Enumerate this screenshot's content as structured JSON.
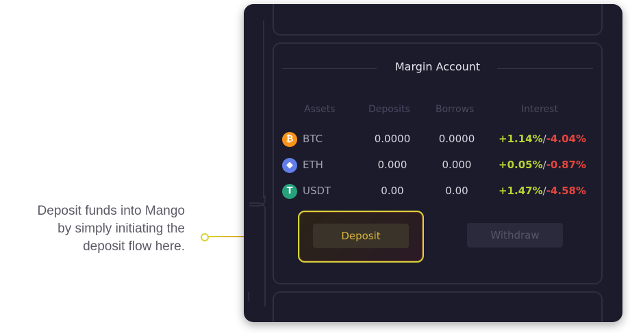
{
  "callout": {
    "lines": [
      "Deposit funds into Mango",
      "by simply initiating the",
      "deposit flow here."
    ]
  },
  "margin_account": {
    "title": "Margin Account",
    "headers": {
      "assets": "Assets",
      "deposits": "Deposits",
      "borrows": "Borrows",
      "interest": "Interest"
    },
    "rows": [
      {
        "icon": "bitcoin-icon",
        "icon_glyph": "₿",
        "icon_color": "#f7931a",
        "asset": "BTC",
        "deposits": "0.0000",
        "borrows": "0.0000",
        "interest_pos": "+1.14%",
        "interest_sep": "/",
        "interest_neg": "-4.04%"
      },
      {
        "icon": "ethereum-icon",
        "icon_glyph": "◆",
        "icon_color": "#627eea",
        "asset": "ETH",
        "deposits": "0.000",
        "borrows": "0.000",
        "interest_pos": "+0.05%",
        "interest_sep": "/",
        "interest_neg": "-0.87%"
      },
      {
        "icon": "tether-icon",
        "icon_glyph": "T",
        "icon_color": "#26a17b",
        "asset": "USDT",
        "deposits": "0.00",
        "borrows": "0.00",
        "interest_pos": "+1.47%",
        "interest_sep": "/",
        "interest_neg": "-4.58%"
      }
    ],
    "deposit_label": "Deposit",
    "withdraw_label": "Withdraw"
  },
  "colors": {
    "panel_bg": "#1c1b2b",
    "positive": "#b8d331",
    "negative": "#e8453c",
    "highlight": "#d8d33a",
    "callout_accent": "#f06a2b"
  }
}
